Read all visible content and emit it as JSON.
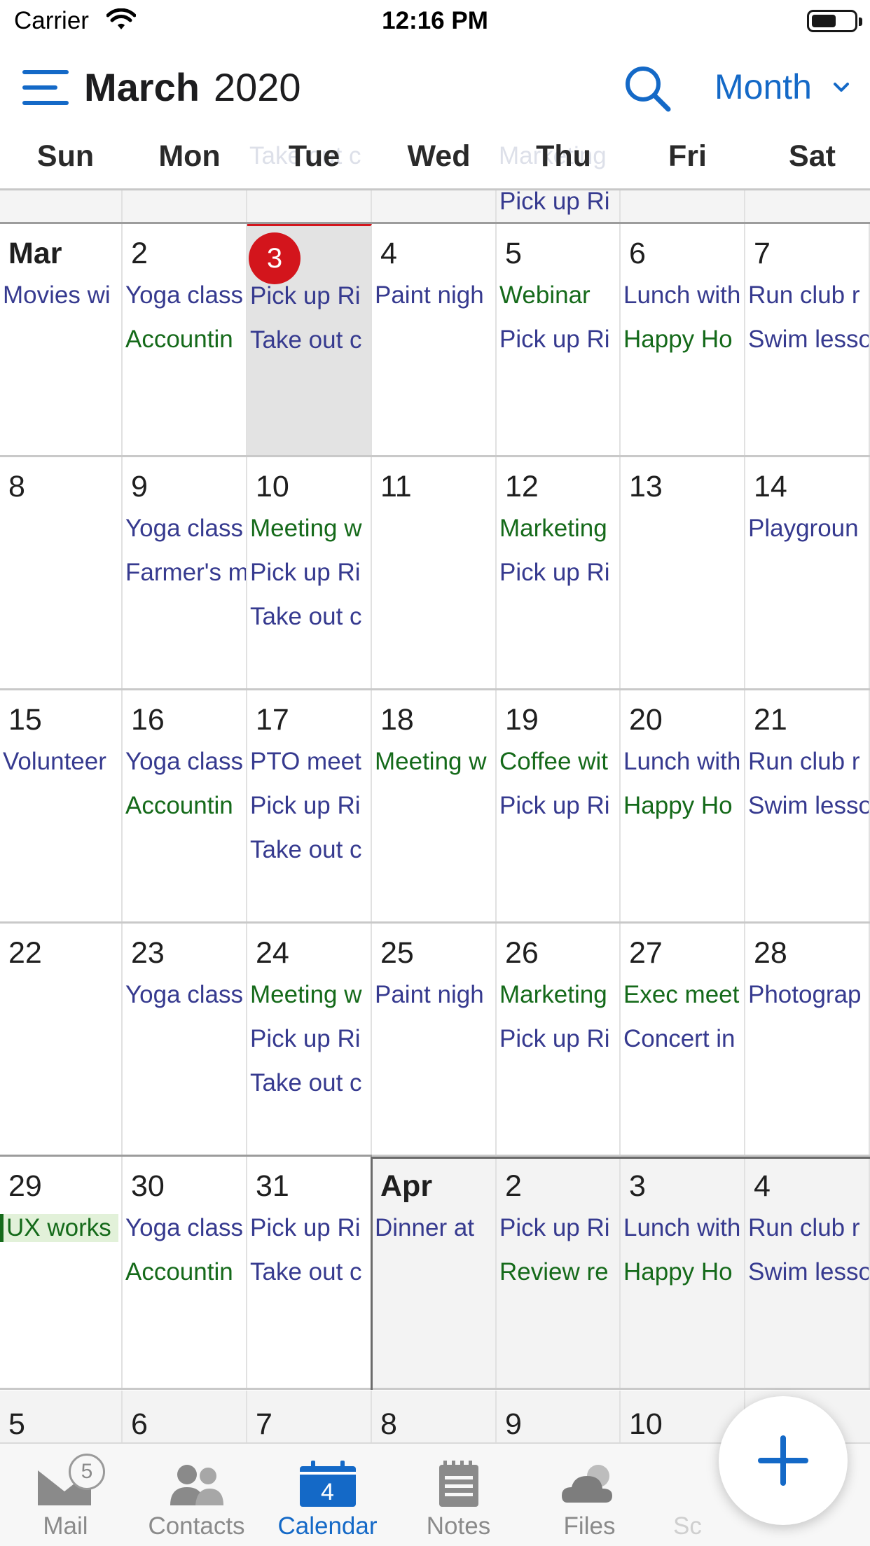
{
  "status_bar": {
    "carrier": "Carrier",
    "time": "12:16 PM"
  },
  "header": {
    "month": "March",
    "year": "2020",
    "view_mode": "Month"
  },
  "weekdays": [
    "Sun",
    "Mon",
    "Tue",
    "Wed",
    "Thu",
    "Fri",
    "Sat"
  ],
  "header_ghost_events": [
    "Take out c",
    "Marketing"
  ],
  "prev_week_sliver": {
    "thu_event": "Pick up Ri"
  },
  "colors": {
    "accent": "#1469c7",
    "today": "#d3151c",
    "event_blue": "#363a8f",
    "event_green": "#156a1a"
  },
  "weeks": [
    {
      "days": [
        {
          "label": "Mar",
          "bold": true,
          "events": [
            {
              "text": "Movies wi",
              "color": "blue"
            }
          ]
        },
        {
          "label": "2",
          "events": [
            {
              "text": "Yoga class",
              "color": "blue"
            },
            {
              "text": "Accountin",
              "color": "green"
            }
          ]
        },
        {
          "label": "3",
          "today": true,
          "events": [
            {
              "text": "Pick up Ri",
              "color": "blue"
            },
            {
              "text": "Take out c",
              "color": "blue"
            }
          ]
        },
        {
          "label": "4",
          "events": [
            {
              "text": "Paint nigh",
              "color": "blue"
            }
          ]
        },
        {
          "label": "5",
          "events": [
            {
              "text": "Webinar",
              "color": "green"
            },
            {
              "text": "Pick up Ri",
              "color": "blue"
            }
          ]
        },
        {
          "label": "6",
          "events": [
            {
              "text": "Lunch with",
              "color": "blue"
            },
            {
              "text": "Happy Ho",
              "color": "green"
            }
          ]
        },
        {
          "label": "7",
          "events": [
            {
              "text": "Run club r",
              "color": "blue"
            },
            {
              "text": "Swim lesso",
              "color": "blue"
            }
          ]
        }
      ]
    },
    {
      "days": [
        {
          "label": "8",
          "events": []
        },
        {
          "label": "9",
          "events": [
            {
              "text": "Yoga class",
              "color": "blue"
            },
            {
              "text": "Farmer's m",
              "color": "blue"
            }
          ]
        },
        {
          "label": "10",
          "events": [
            {
              "text": "Meeting w",
              "color": "green"
            },
            {
              "text": "Pick up Ri",
              "color": "blue"
            },
            {
              "text": "Take out c",
              "color": "blue"
            }
          ]
        },
        {
          "label": "11",
          "events": []
        },
        {
          "label": "12",
          "events": [
            {
              "text": "Marketing",
              "color": "green"
            },
            {
              "text": "Pick up Ri",
              "color": "blue"
            }
          ]
        },
        {
          "label": "13",
          "events": []
        },
        {
          "label": "14",
          "events": [
            {
              "text": "Playgroun",
              "color": "blue"
            }
          ]
        }
      ]
    },
    {
      "days": [
        {
          "label": "15",
          "events": [
            {
              "text": "Volunteer",
              "color": "blue"
            }
          ]
        },
        {
          "label": "16",
          "events": [
            {
              "text": "Yoga class",
              "color": "blue"
            },
            {
              "text": "Accountin",
              "color": "green"
            }
          ]
        },
        {
          "label": "17",
          "events": [
            {
              "text": "PTO meet",
              "color": "blue"
            },
            {
              "text": "Pick up Ri",
              "color": "blue"
            },
            {
              "text": "Take out c",
              "color": "blue"
            }
          ]
        },
        {
          "label": "18",
          "events": [
            {
              "text": "Meeting w",
              "color": "green"
            }
          ]
        },
        {
          "label": "19",
          "events": [
            {
              "text": "Coffee wit",
              "color": "green"
            },
            {
              "text": "Pick up Ri",
              "color": "blue"
            }
          ]
        },
        {
          "label": "20",
          "events": [
            {
              "text": "Lunch with",
              "color": "blue"
            },
            {
              "text": "Happy Ho",
              "color": "green"
            }
          ]
        },
        {
          "label": "21",
          "events": [
            {
              "text": "Run club r",
              "color": "blue"
            },
            {
              "text": "Swim lesso",
              "color": "blue"
            }
          ]
        }
      ]
    },
    {
      "days": [
        {
          "label": "22",
          "events": []
        },
        {
          "label": "23",
          "events": [
            {
              "text": "Yoga class",
              "color": "blue"
            }
          ]
        },
        {
          "label": "24",
          "events": [
            {
              "text": "Meeting w",
              "color": "green"
            },
            {
              "text": "Pick up Ri",
              "color": "blue"
            },
            {
              "text": "Take out c",
              "color": "blue"
            }
          ]
        },
        {
          "label": "25",
          "events": [
            {
              "text": "Paint nigh",
              "color": "blue"
            }
          ]
        },
        {
          "label": "26",
          "events": [
            {
              "text": "Marketing",
              "color": "green"
            },
            {
              "text": "Pick up Ri",
              "color": "blue"
            }
          ]
        },
        {
          "label": "27",
          "events": [
            {
              "text": "Exec meet",
              "color": "green"
            },
            {
              "text": "Concert in",
              "color": "blue"
            }
          ]
        },
        {
          "label": "28",
          "events": [
            {
              "text": "Photograp",
              "color": "blue"
            }
          ]
        }
      ]
    },
    {
      "days": [
        {
          "label": "29",
          "events": [
            {
              "text": "UX works",
              "color": "green",
              "highlight": true
            }
          ]
        },
        {
          "label": "30",
          "events": [
            {
              "text": "Yoga class",
              "color": "blue"
            },
            {
              "text": "Accountin",
              "color": "green"
            }
          ]
        },
        {
          "label": "31",
          "events": [
            {
              "text": "Pick up Ri",
              "color": "blue"
            },
            {
              "text": "Take out c",
              "color": "blue"
            }
          ]
        },
        {
          "label": "Apr",
          "bold": true,
          "shaded": true,
          "events": [
            {
              "text": "Dinner at",
              "color": "blue"
            }
          ]
        },
        {
          "label": "2",
          "shaded": true,
          "events": [
            {
              "text": "Pick up Ri",
              "color": "blue"
            },
            {
              "text": "Review re",
              "color": "green"
            }
          ]
        },
        {
          "label": "3",
          "shaded": true,
          "events": [
            {
              "text": "Lunch with",
              "color": "blue"
            },
            {
              "text": "Happy Ho",
              "color": "green"
            }
          ]
        },
        {
          "label": "4",
          "shaded": true,
          "events": [
            {
              "text": "Run club r",
              "color": "blue"
            },
            {
              "text": "Swim lesso",
              "color": "blue"
            }
          ]
        }
      ]
    }
  ],
  "partial_week": [
    "5",
    "6",
    "7",
    "8",
    "9",
    "10"
  ],
  "tabs": [
    {
      "label": "Mail",
      "icon": "mail-icon",
      "badge": "5"
    },
    {
      "label": "Contacts",
      "icon": "contacts-icon"
    },
    {
      "label": "Calendar",
      "icon": "calendar-icon",
      "active": true,
      "icon_text": "4"
    },
    {
      "label": "Notes",
      "icon": "notes-icon"
    },
    {
      "label": "Files",
      "icon": "files-icon"
    },
    {
      "label": "Sc",
      "icon": "more-icon"
    }
  ],
  "fab": {
    "icon": "plus-icon"
  }
}
